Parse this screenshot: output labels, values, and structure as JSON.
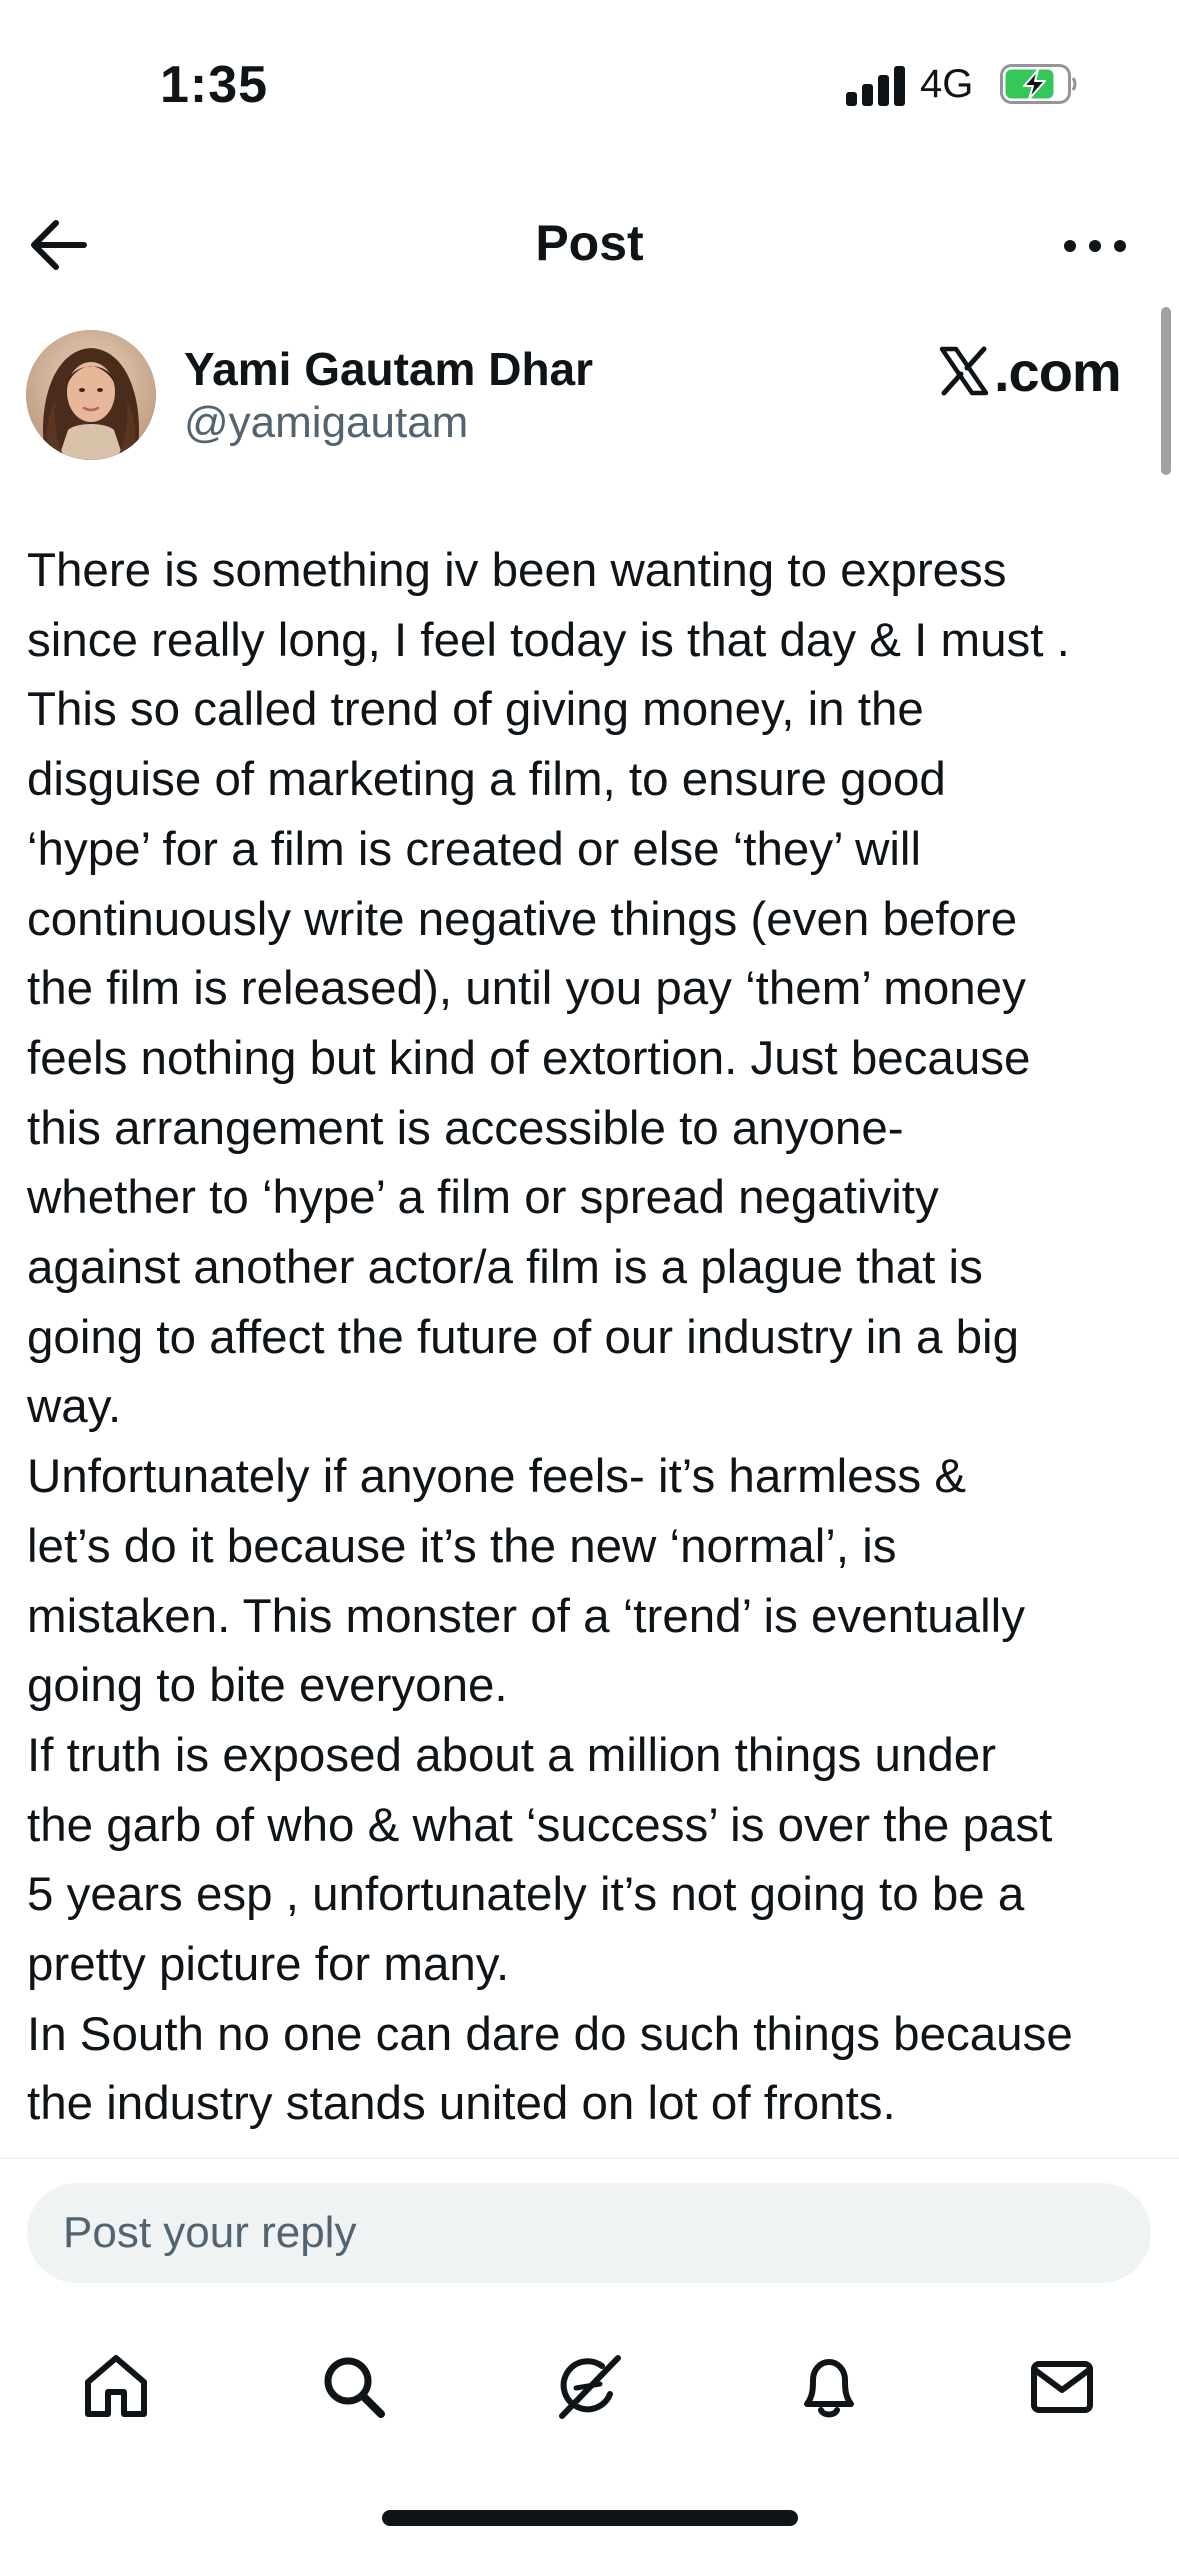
{
  "status_bar": {
    "time": "1:35",
    "network": "4G",
    "battery_charging": true,
    "battery_color": "#34c759"
  },
  "header": {
    "title": "Post",
    "back_icon": "arrow-left-icon",
    "more_icon": "ellipsis-icon"
  },
  "author": {
    "display_name": "Yami Gautam Dhar",
    "handle": "@yamigautam",
    "source": ".com",
    "source_icon": "x-logo-icon"
  },
  "post": {
    "lines": [
      "There is something iv been wanting to express",
      "since really long, I feel today is that day & I must .",
      "This so called trend of giving money, in the",
      "disguise of marketing a film, to ensure good",
      "‘hype’ for a film is created or else ‘they’ will",
      "continuously write negative things (even before",
      "the film is released), until you pay ‘them’ money",
      "feels nothing but kind of extortion. Just because",
      "this arrangement is accessible to anyone-",
      "whether to ‘hype’ a film or spread negativity",
      "against another actor/a film is a plague that is",
      "going to affect the future of our industry in a big",
      "way.",
      "Unfortunately if anyone feels- it’s harmless &",
      "let’s do it because it’s the new ‘normal’, is",
      "mistaken. This monster of a ‘trend’ is eventually",
      "going to bite everyone.",
      "If truth is exposed about a million things under",
      "the garb of who & what ‘success’ is over the past",
      "5 years esp , unfortunately it’s not going to be a",
      "pretty picture for many.",
      "In South no one can dare do such things because",
      "the industry stands united on lot of fronts."
    ]
  },
  "reply": {
    "placeholder": "Post your reply"
  },
  "bottom_nav": {
    "items": [
      {
        "icon": "home-icon"
      },
      {
        "icon": "search-icon"
      },
      {
        "icon": "grok-icon"
      },
      {
        "icon": "bell-icon"
      },
      {
        "icon": "mail-icon"
      }
    ]
  }
}
